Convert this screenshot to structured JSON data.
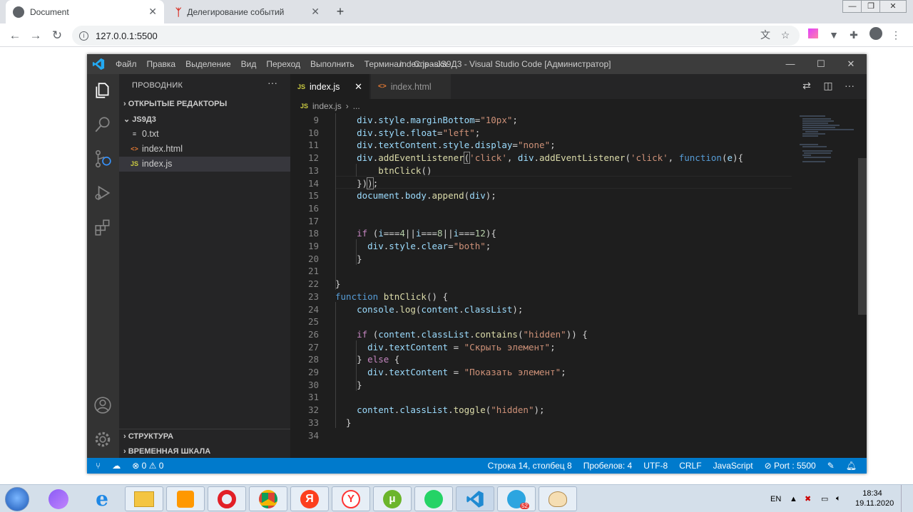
{
  "browser": {
    "tabs": [
      {
        "title": "Document"
      },
      {
        "title": "Делегирование событий"
      }
    ],
    "address": "127.0.0.1:5500"
  },
  "vscode": {
    "menu": [
      "Файл",
      "Правка",
      "Выделение",
      "Вид",
      "Переход",
      "Выполнить",
      "Терминал",
      "Справка"
    ],
    "window_title": "index.js - JS9Д3 - Visual Studio Code [Администратор]",
    "explorer": {
      "header": "ПРОВОДНИК",
      "open_editors": "ОТКРЫТЫЕ РЕДАКТОРЫ",
      "folder": "JS9Д3",
      "files": [
        {
          "name": "0.txt",
          "icon": "≡"
        },
        {
          "name": "index.html",
          "icon": "<>"
        },
        {
          "name": "index.js",
          "icon": "JS"
        }
      ],
      "outline": "СТРУКТУРА",
      "timeline": "ВРЕМЕННАЯ ШКАЛА"
    },
    "editor_tabs": [
      {
        "name": "index.js",
        "icon": "JS"
      },
      {
        "name": "index.html",
        "icon": "<>"
      }
    ],
    "breadcrumb": [
      "index.js",
      "..."
    ],
    "code_lines": [
      {
        "n": "9",
        "t": ""
      },
      {
        "n": "10",
        "t": ""
      },
      {
        "n": "11",
        "t": ""
      },
      {
        "n": "12",
        "t": ""
      },
      {
        "n": "13",
        "t": ""
      },
      {
        "n": "14",
        "t": ""
      },
      {
        "n": "15",
        "t": ""
      },
      {
        "n": "16",
        "t": ""
      },
      {
        "n": "17",
        "t": ""
      },
      {
        "n": "18",
        "t": ""
      },
      {
        "n": "19",
        "t": ""
      },
      {
        "n": "20",
        "t": ""
      },
      {
        "n": "21",
        "t": ""
      },
      {
        "n": "22",
        "t": ""
      },
      {
        "n": "23",
        "t": ""
      },
      {
        "n": "24",
        "t": ""
      },
      {
        "n": "25",
        "t": ""
      },
      {
        "n": "26",
        "t": ""
      },
      {
        "n": "27",
        "t": ""
      },
      {
        "n": "28",
        "t": ""
      },
      {
        "n": "29",
        "t": ""
      },
      {
        "n": "30",
        "t": ""
      },
      {
        "n": "31",
        "t": ""
      },
      {
        "n": "32",
        "t": ""
      },
      {
        "n": "33",
        "t": ""
      },
      {
        "n": "34",
        "t": ""
      }
    ],
    "code_html": [
      "    <span class='v'>div</span>.<span class='v'>style</span>.<span class='v'>marginBottom</span>=<span class='s'>\"10px\"</span>;",
      "    <span class='v'>div</span>.<span class='v'>style</span>.<span class='v'>float</span>=<span class='s'>\"left\"</span>;",
      "    <span class='v'>div</span>.<span class='v'>textContent</span>.<span class='v'>style</span>.<span class='v'>display</span>=<span class='s'>\"none\"</span>;",
      "    <span class='v'>div</span>.<span class='f'>addEventListener</span><span class='br'>(</span><span class='s'>'click'</span>, <span class='v'>div</span>.<span class='f'>addEventListener</span>(<span class='s'>'click'</span>, <span class='k'>function</span>(<span class='v'>e</span>){",
      "        <span class='f'>btnClick</span>()",
      "    })<span class='br'>)</span>;",
      "    <span class='v'>document</span>.<span class='v'>body</span>.<span class='f'>append</span>(<span class='v'>div</span>);",
      "",
      "",
      "    <span class='c'>if</span> (<span class='v'>i</span>===<span class='n'>4</span>||<span class='v'>i</span>===<span class='n'>8</span>||<span class='v'>i</span>===<span class='n'>12</span>){",
      "      <span class='v'>div</span>.<span class='v'>style</span>.<span class='v'>clear</span>=<span class='s'>\"both\"</span>;",
      "    }",
      "",
      "}",
      "<span class='k'>function</span> <span class='f'>btnClick</span>() {",
      "    <span class='v'>console</span>.<span class='f'>log</span>(<span class='v'>content</span>.<span class='v'>classList</span>);",
      "",
      "    <span class='c'>if</span> (<span class='v'>content</span>.<span class='v'>classList</span>.<span class='f'>contains</span>(<span class='s'>\"hidden\"</span>)) {",
      "      <span class='v'>div</span>.<span class='v'>textContent</span> = <span class='s'>\"Скрыть элемент\"</span>;",
      "    } <span class='c'>else</span> {",
      "      <span class='v'>div</span>.<span class='v'>textContent</span> = <span class='s'>\"Показать элемент\"</span>;",
      "    }",
      "",
      "    <span class='v'>content</span>.<span class='v'>classList</span>.<span class='f'>toggle</span>(<span class='s'>\"hidden\"</span>);",
      "  }",
      ""
    ],
    "status": {
      "errors": "0",
      "warnings": "0",
      "position": "Строка 14, столбец 8",
      "spaces": "Пробелов: 4",
      "encoding": "UTF-8",
      "eol": "CRLF",
      "language": "JavaScript",
      "port": "Port : 5500"
    }
  },
  "taskbar": {
    "lang": "EN",
    "time": "18:34",
    "date": "19.11.2020",
    "telegram_badge": "52"
  },
  "colors": {
    "accent": "#007acc",
    "keyword": "#569cd6",
    "control": "#c586c0",
    "string": "#ce9178",
    "function": "#dcdcaa",
    "variable": "#9cdcfe",
    "number": "#b5cea8"
  }
}
